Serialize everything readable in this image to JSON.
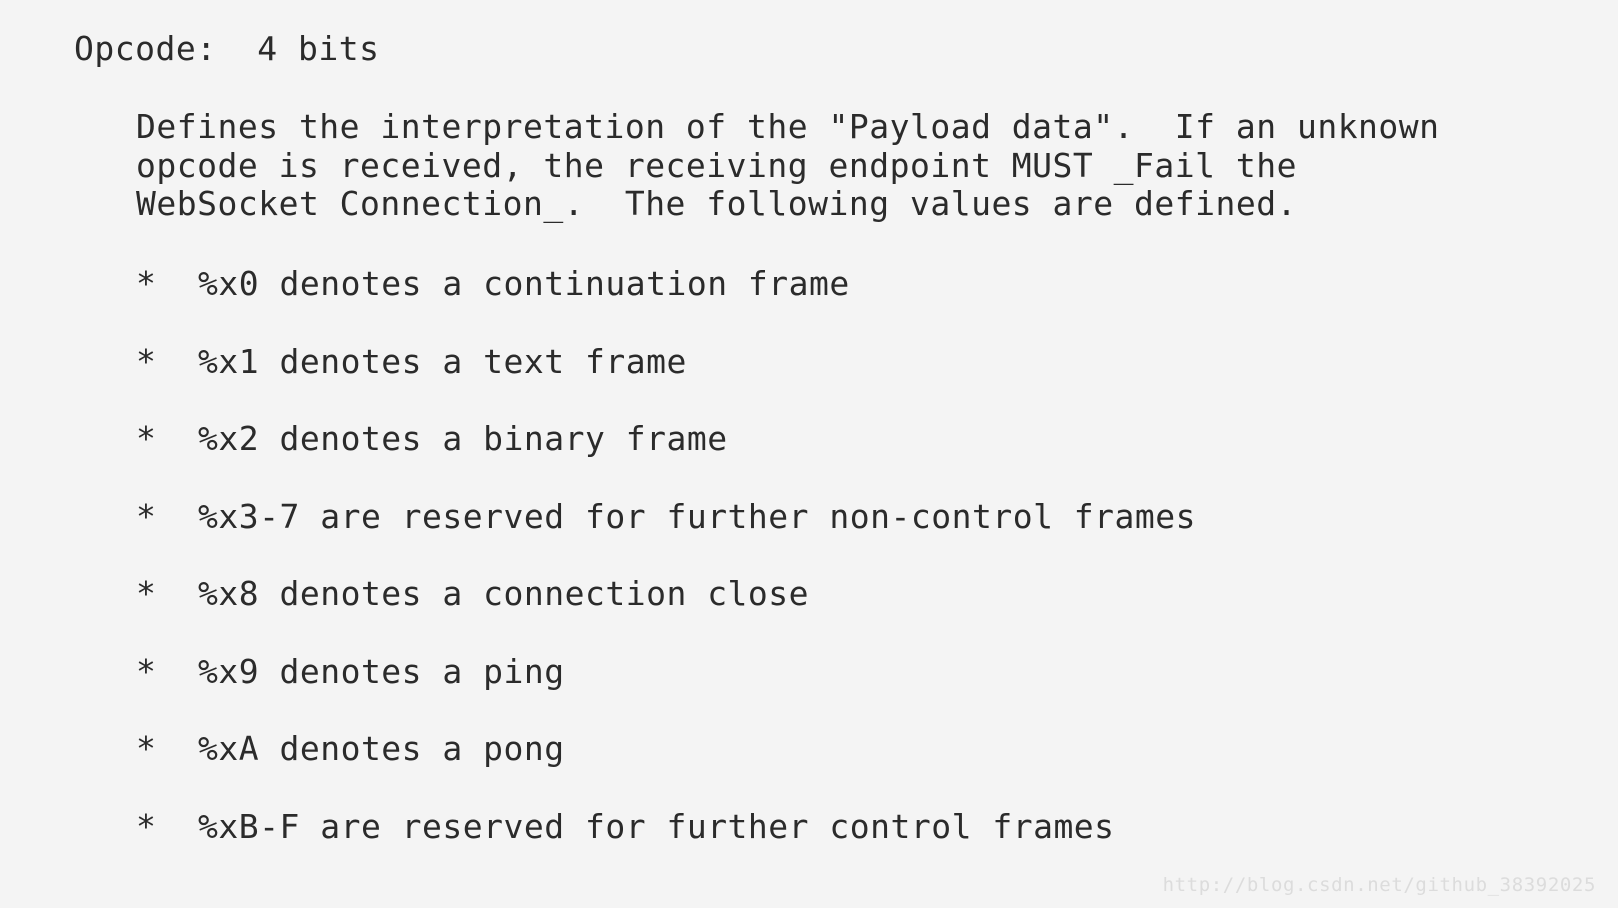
{
  "page": {
    "background_color": "#f4f4f4",
    "text_color": "#2b2b2b",
    "watermark_color": "#dcdcdc"
  },
  "section": {
    "heading": "Opcode:  4 bits"
  },
  "description": {
    "lines": [
      "Defines the interpretation of the \"Payload data\".  If an unknown",
      "opcode is received, the receiving endpoint MUST _Fail the",
      "WebSocket Connection_.  The following values are defined."
    ]
  },
  "opcodes": {
    "bullet": "*",
    "items": [
      {
        "code": "%x0",
        "text": "%x0 denotes a continuation frame"
      },
      {
        "code": "%x1",
        "text": "%x1 denotes a text frame"
      },
      {
        "code": "%x2",
        "text": "%x2 denotes a binary frame"
      },
      {
        "code": "%x3-7",
        "text": "%x3-7 are reserved for further non-control frames"
      },
      {
        "code": "%x8",
        "text": "%x8 denotes a connection close"
      },
      {
        "code": "%x9",
        "text": "%x9 denotes a ping"
      },
      {
        "code": "%xA",
        "text": "%xA denotes a pong"
      },
      {
        "code": "%xB-F",
        "text": "%xB-F are reserved for further control frames"
      }
    ]
  },
  "watermark": {
    "text": "http://blog.csdn.net/github_38392025"
  }
}
